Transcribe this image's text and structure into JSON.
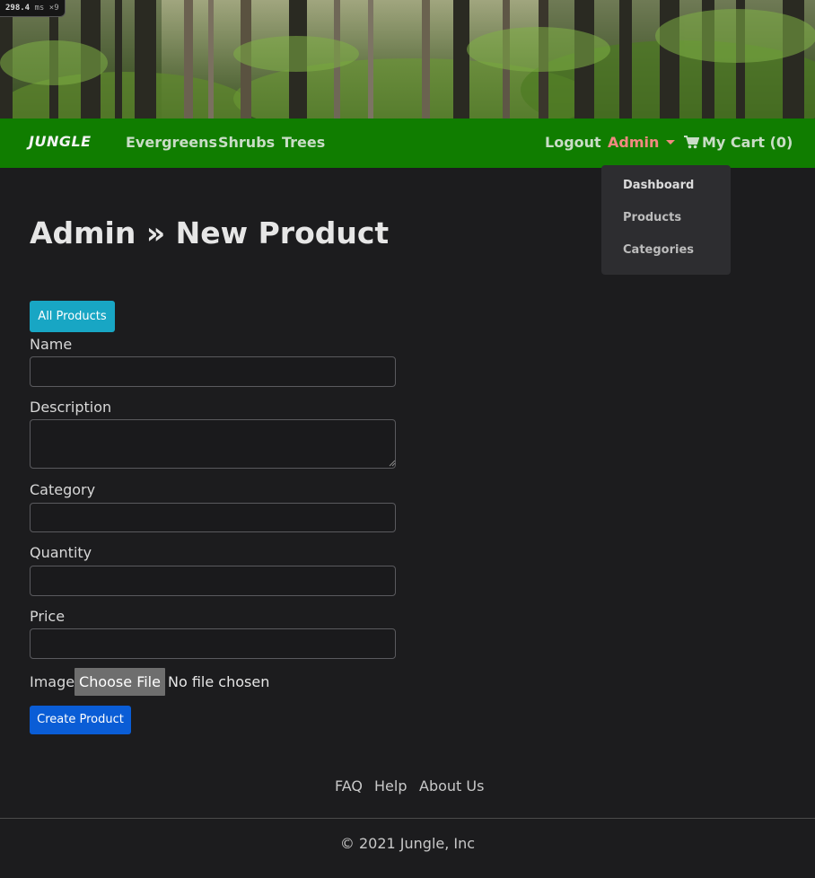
{
  "perf_badge": {
    "value": "298.4",
    "unit": "ms ×9"
  },
  "nav": {
    "brand": "JUNGLE",
    "categories": [
      "Evergreens",
      "Shrubs",
      "Trees"
    ],
    "logout": "Logout",
    "admin": "Admin",
    "cart": "My Cart (0)"
  },
  "admin_menu": {
    "items": [
      "Dashboard",
      "Products",
      "Categories"
    ]
  },
  "page": {
    "title": "Admin » New Product",
    "all_products_button": "All Products"
  },
  "form": {
    "name_label": "Name",
    "name_value": "",
    "description_label": "Description",
    "description_value": "",
    "category_label": "Category",
    "category_value": "",
    "quantity_label": "Quantity",
    "quantity_value": "",
    "price_label": "Price",
    "price_value": "",
    "image_label": "Image",
    "choose_file_button": "Choose File",
    "file_status": "No file chosen",
    "submit_button": "Create Product"
  },
  "footer": {
    "links": [
      "FAQ",
      "Help",
      "About Us"
    ],
    "copyright": "© 2021 Jungle, Inc"
  },
  "colors": {
    "navbar": "#107d00",
    "admin_link": "#f08a80",
    "all_products_button": "#18a6c4",
    "create_button": "#0a5dd6",
    "background": "#1c1c1e"
  }
}
